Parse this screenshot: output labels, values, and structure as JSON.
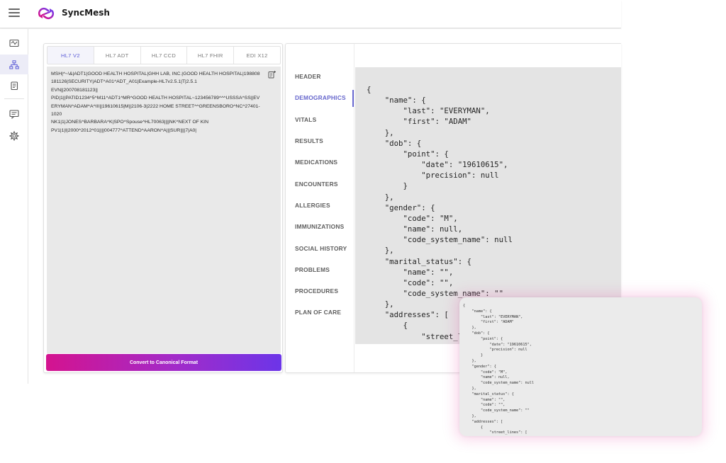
{
  "app": {
    "name": "SyncMesh",
    "brand_colors": {
      "magenta": "#d4138f",
      "purple": "#6c35e8",
      "accent": "#5b5bd6"
    }
  },
  "rail": {
    "items": [
      {
        "icon": "sliders-icon",
        "active": false
      },
      {
        "icon": "hierarchy-icon",
        "active": true
      },
      {
        "icon": "document-icon",
        "active": false
      },
      {
        "icon": "message-icon",
        "active": false
      },
      {
        "icon": "gear-icon",
        "active": false
      }
    ]
  },
  "input_panel": {
    "tabs": [
      "HL7 V2",
      "HL7 ADT",
      "HL7 CCD",
      "HL7 FHIR",
      "EDI X12"
    ],
    "active_tab": "HL7 V2",
    "message": "MSH|^~\\&|ADT1|GOOD HEALTH HOSPITAL|GHH LAB, INC.|GOOD HEALTH HOSPITAL|198808181126|SECURITY|ADT^A01^ADT_A01|Example-HL7v2.5.1|T|2.5.1\nEVN||200708181123||\nPID|1||PATID1234^5^M11^ADT1^MR^GOOD HEALTH HOSPITAL~123456789^^^USSSA^SS||EVERYMAN^ADAM^A^III||19610615|M||2106-3|2222 HOME STREET^^GREENSBORO^NC^27401-1020\nNK1|1|JONES^BARBARA^K|SPO^Spouse^HL70063||||NK^NEXT OF KIN\nPV1|1|I|2000^2012^01||||004777^ATTEND^AARON^A|||SUR||||7|A0|",
    "convert_label": "Convert to Canonical Format"
  },
  "output_panel": {
    "sections": [
      "HEADER",
      "DEMOGRAPHICS",
      "VITALS",
      "RESULTS",
      "MEDICATIONS",
      "ENCOUNTERS",
      "ALLERGIES",
      "IMMUNIZATIONS",
      "SOCIAL HISTORY",
      "PROBLEMS",
      "PROCEDURES",
      "PLAN OF CARE"
    ],
    "active_section": "DEMOGRAPHICS",
    "json": "{\n    \"name\": {\n        \"last\": \"EVERYMAN\",\n        \"first\": \"ADAM\"\n    },\n    \"dob\": {\n        \"point\": {\n            \"date\": \"19610615\",\n            \"precision\": null\n        }\n    },\n    \"gender\": {\n        \"code\": \"M\",\n        \"name\": null,\n        \"code_system_name\": null\n    },\n    \"marital_status\": {\n        \"name\": \"\",\n        \"code\": \"\",\n        \"code_system_name\": \"\"\n    },\n    \"addresses\": [\n        {\n            \"street_lines\": ["
  },
  "floating_card": {
    "json": "{\n    \"name\": {\n        \"last\": \"EVERYMAN\",\n        \"first\": \"ADAM\"\n    },\n    \"dob\": {\n        \"point\": {\n            \"date\": \"19610615\",\n            \"precision\": null\n        }\n    },\n    \"gender\": {\n        \"code\": \"M\",\n        \"name\": null,\n        \"code_system_name\": null\n    },\n    \"marital_status\": {\n        \"name\": \"\",\n        \"code\": \"\",\n        \"code_system_name\": \"\"\n    },\n    \"addresses\": [\n        {\n            \"street_lines\": ["
  }
}
